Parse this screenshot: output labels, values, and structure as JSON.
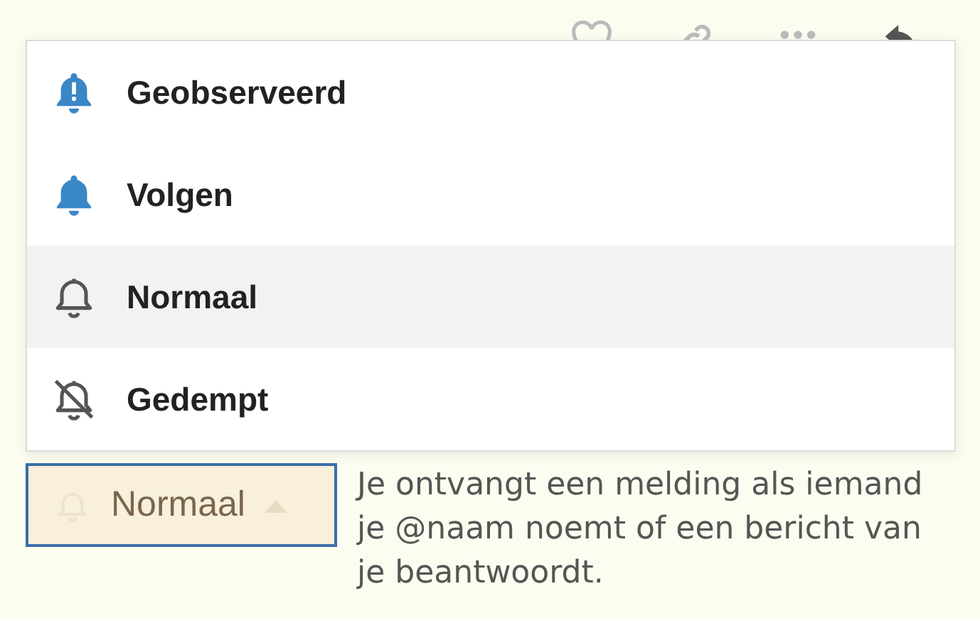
{
  "menu": {
    "options": [
      {
        "label": "Geobserveerd",
        "kind": "watching",
        "selected": false
      },
      {
        "label": "Volgen",
        "kind": "tracking",
        "selected": false
      },
      {
        "label": "Normaal",
        "kind": "normal",
        "selected": true
      },
      {
        "label": "Gedempt",
        "kind": "muted",
        "selected": false
      }
    ]
  },
  "dropdown": {
    "label": "Normaal",
    "expanded": true
  },
  "description": "Je ontvangt een melding als iemand je @naam noemt of een bericht van je beantwoordt."
}
